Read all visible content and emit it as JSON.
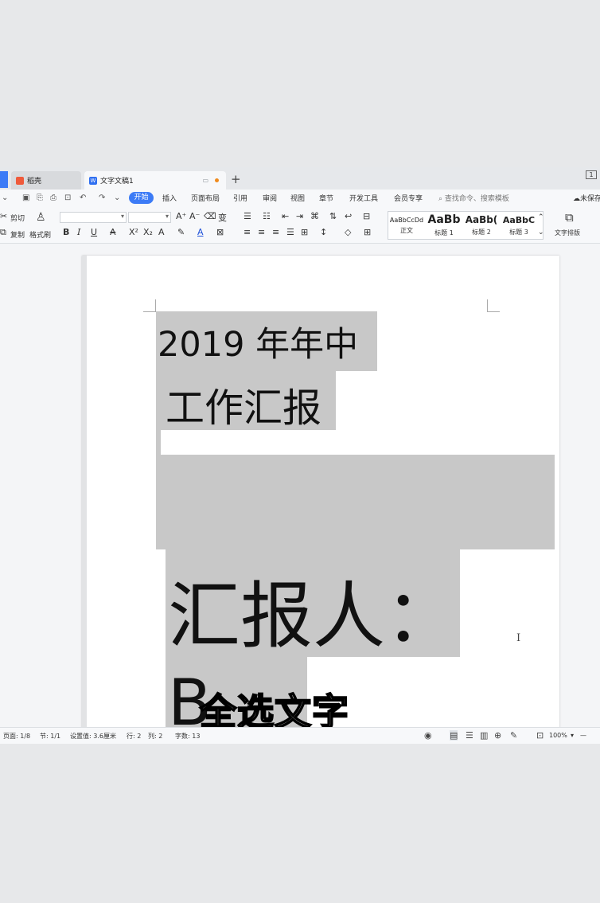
{
  "tabs": [
    {
      "label": "稻壳",
      "active": false
    },
    {
      "label": "文字文稿1",
      "active": true
    }
  ],
  "new_tab_label": "+",
  "window_control": "1",
  "menu": {
    "start": "开始",
    "items": [
      "插入",
      "页面布局",
      "引用",
      "审阅",
      "视图",
      "章节",
      "开发工具",
      "会员专享"
    ],
    "search_placeholder": "查找命令、搜索模板",
    "unsaved": "未保存"
  },
  "ribbon": {
    "cut": "剪切",
    "copy": "复制",
    "format_painter": "格式刷",
    "styles": [
      {
        "sample": "AaBbCcDd",
        "name": "正文"
      },
      {
        "sample": "AaBb",
        "name": "标题 1"
      },
      {
        "sample": "AaBb(",
        "name": "标题 2"
      },
      {
        "sample": "AaBbC",
        "name": "标题 3"
      }
    ],
    "text_layout": "文字排版"
  },
  "document": {
    "line1": "2019 年年中",
    "line2": "工作汇报",
    "line3": "汇报人：",
    "line4": "B"
  },
  "caption": "全选文字",
  "status": {
    "page": "页面: 1/8",
    "section": "节: 1/1",
    "setting": "设置值: 3.6厘米",
    "row": "行: 2",
    "col": "列: 2",
    "word_count": "字数: 13",
    "zoom": "100%"
  },
  "colors": {
    "accent": "#3c7bf6",
    "selection": "#c8c8c8",
    "unsaved_dot": "#f08a1d"
  }
}
